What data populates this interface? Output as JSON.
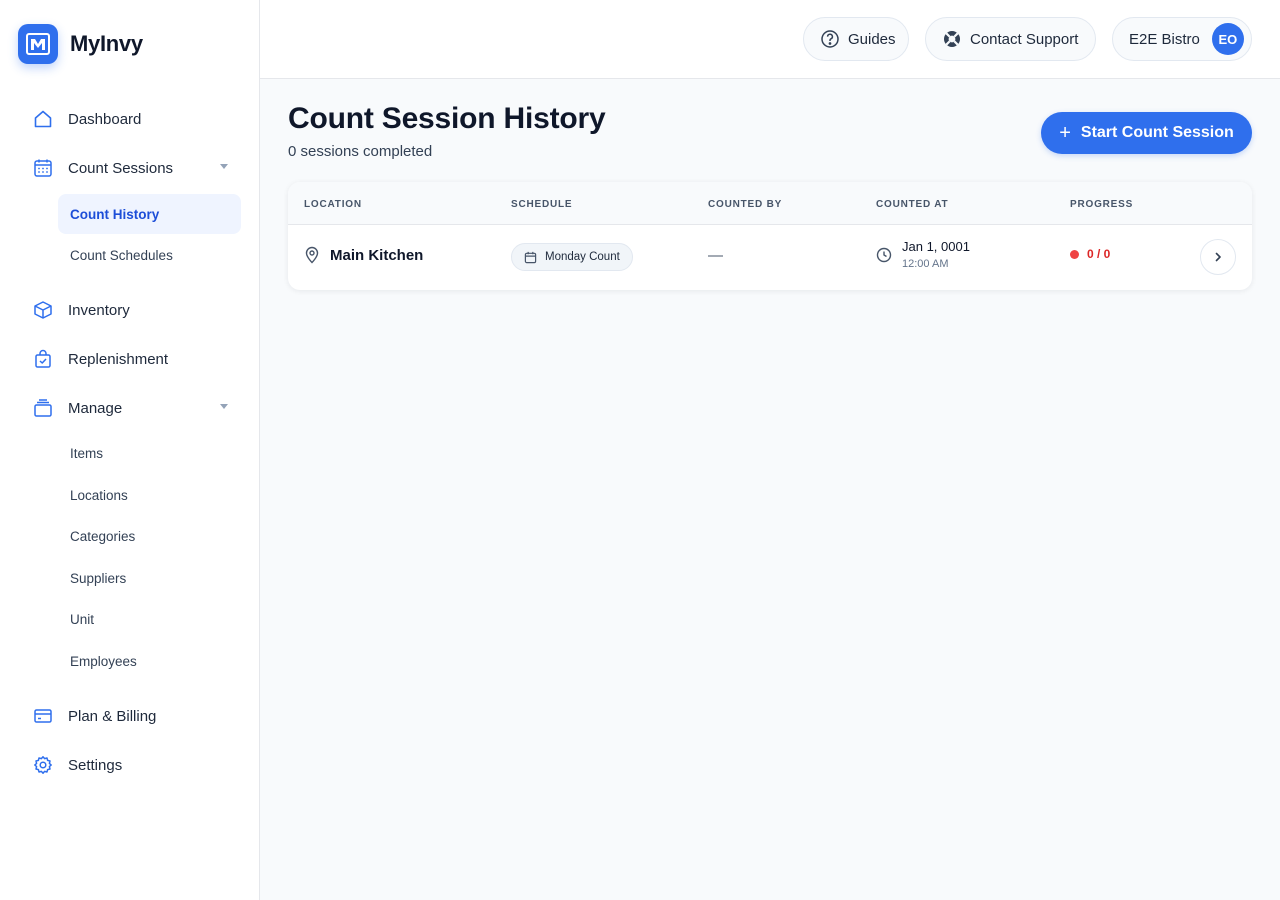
{
  "app": {
    "name": "MyInvy",
    "brand_color": "#2f6fed",
    "logo_icon": "m-logo-icon"
  },
  "sidebar": {
    "items": [
      {
        "label": "Dashboard",
        "icon": "home-icon"
      },
      {
        "label": "Count Sessions",
        "icon": "calendar-grid-icon",
        "expanded": true,
        "children": [
          {
            "label": "Count History",
            "active": true
          },
          {
            "label": "Count Schedules"
          }
        ]
      },
      {
        "label": "Inventory",
        "icon": "box-icon"
      },
      {
        "label": "Replenishment",
        "icon": "shopping-bag-check-icon"
      },
      {
        "label": "Manage",
        "icon": "folder-stack-icon",
        "expanded": true,
        "children": [
          {
            "label": "Items"
          },
          {
            "label": "Locations"
          },
          {
            "label": "Categories"
          },
          {
            "label": "Suppliers"
          },
          {
            "label": "Unit"
          },
          {
            "label": "Employees"
          }
        ]
      },
      {
        "label": "Plan & Billing",
        "icon": "credit-card-icon"
      },
      {
        "label": "Settings",
        "icon": "gear-icon"
      }
    ]
  },
  "topbar": {
    "guides_label": "Guides",
    "support_label": "Contact Support",
    "account_name": "E2E Bistro",
    "avatar_initials": "EO"
  },
  "main": {
    "title": "Count Session History",
    "subtitle": "0 sessions completed",
    "start_button_label": "Start Count Session"
  },
  "table": {
    "columns": [
      "LOCATION",
      "SCHEDULE",
      "COUNTED BY",
      "COUNTED AT",
      "PROGRESS"
    ],
    "rows": [
      {
        "location": "Main Kitchen",
        "schedule": "Monday Count",
        "counted_by": "—",
        "counted_date": "Jan 1, 0001",
        "counted_time": "12:00 AM",
        "progress": "0 / 0",
        "progress_color": "#dc2626"
      }
    ]
  }
}
